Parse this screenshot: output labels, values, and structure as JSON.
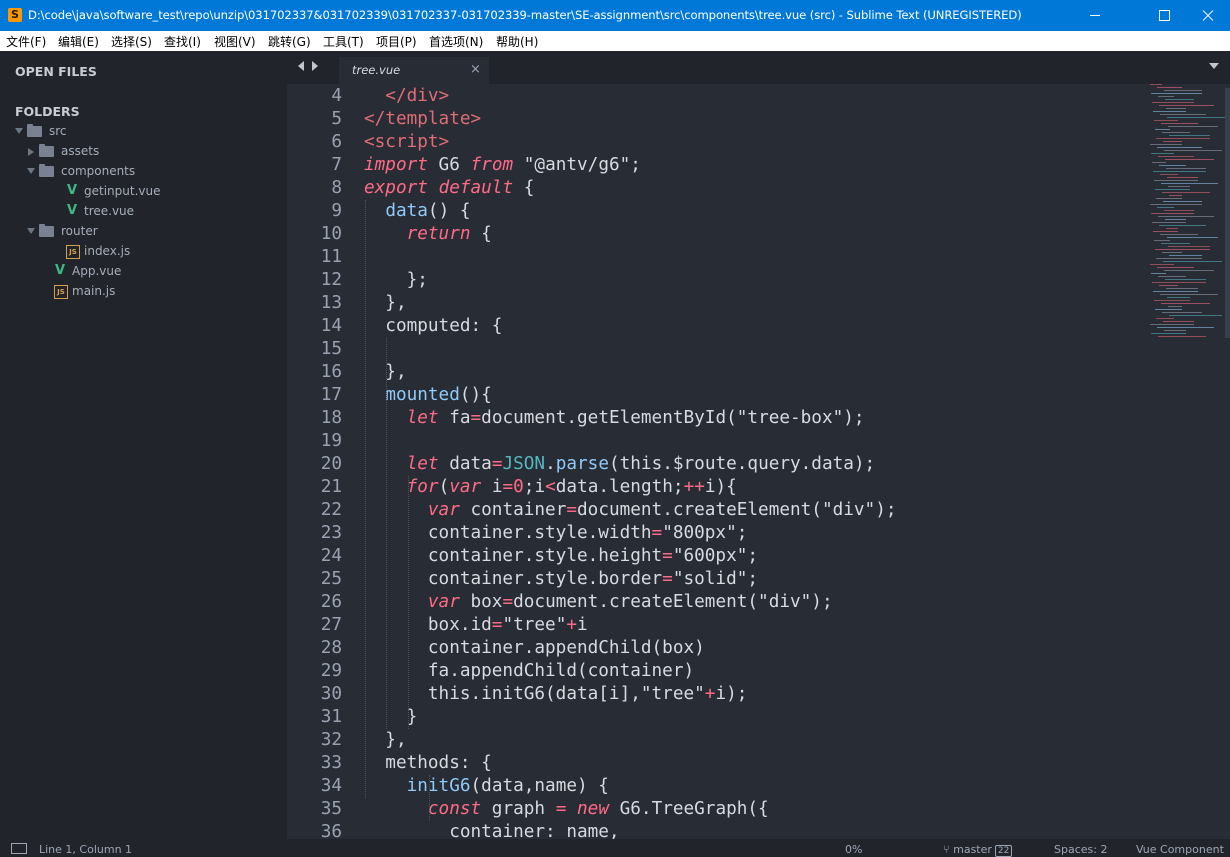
{
  "window": {
    "title": "D:\\code\\java\\software_test\\repo\\unzip\\031702337&031702339\\031702337-031702339-master\\SE-assignment\\src\\components\\tree.vue (src) - Sublime Text (UNREGISTERED)",
    "app_icon_letter": "S"
  },
  "menu": [
    "文件(F)",
    "编辑(E)",
    "选择(S)",
    "查找(I)",
    "视图(V)",
    "跳转(G)",
    "工具(T)",
    "项目(P)",
    "首选项(N)",
    "帮助(H)"
  ],
  "sidebar": {
    "open_files_label": "OPEN FILES",
    "folders_label": "FOLDERS",
    "tree": [
      {
        "name": "src",
        "type": "folder",
        "open": true,
        "depth": 0
      },
      {
        "name": "assets",
        "type": "folder",
        "open": false,
        "depth": 1
      },
      {
        "name": "components",
        "type": "folder",
        "open": true,
        "depth": 1
      },
      {
        "name": "getinput.vue",
        "type": "vue",
        "depth": 2
      },
      {
        "name": "tree.vue",
        "type": "vue",
        "depth": 2
      },
      {
        "name": "router",
        "type": "folder",
        "open": true,
        "depth": 1
      },
      {
        "name": "index.js",
        "type": "js",
        "depth": 2
      },
      {
        "name": "App.vue",
        "type": "vue",
        "depth": 1
      },
      {
        "name": "main.js",
        "type": "js",
        "depth": 1
      }
    ]
  },
  "tab": {
    "label": "tree.vue",
    "close_symbol": "×"
  },
  "editor": {
    "line_numbers": [
      4,
      5,
      6,
      7,
      8,
      9,
      10,
      11,
      12,
      13,
      14,
      15,
      16,
      17,
      18,
      19,
      20,
      21,
      22,
      23,
      24,
      25,
      26,
      27,
      28,
      29,
      30,
      31,
      32,
      33,
      34,
      35,
      36
    ],
    "lines": [
      [
        [
          "tag",
          "  </div>"
        ]
      ],
      [
        [
          "tag",
          "</template>"
        ]
      ],
      [
        [
          "tag",
          "<script>"
        ]
      ],
      [
        [
          "kw",
          "import"
        ],
        [
          "pl",
          " G6 "
        ],
        [
          "kw",
          "from"
        ],
        [
          "pl",
          " "
        ],
        [
          "str",
          "\"@antv/g6\""
        ],
        [
          "pl",
          ";"
        ]
      ],
      [
        [
          "kw",
          "export"
        ],
        [
          "pl",
          " "
        ],
        [
          "kw",
          "default"
        ],
        [
          "pl",
          " {"
        ]
      ],
      [
        [
          "pl",
          "  "
        ],
        [
          "fn",
          "data"
        ],
        [
          "pl",
          "() {"
        ]
      ],
      [
        [
          "pl",
          "    "
        ],
        [
          "kw",
          "return"
        ],
        [
          "pl",
          " {"
        ]
      ],
      [
        [
          "pl",
          ""
        ]
      ],
      [
        [
          "pl",
          "    };"
        ]
      ],
      [
        [
          "pl",
          "  },"
        ]
      ],
      [
        [
          "pl",
          "  computed: {"
        ]
      ],
      [
        [
          "pl",
          ""
        ]
      ],
      [
        [
          "pl",
          "  },"
        ]
      ],
      [
        [
          "pl",
          "  "
        ],
        [
          "fn",
          "mounted"
        ],
        [
          "pl",
          "(){"
        ]
      ],
      [
        [
          "pl",
          "    "
        ],
        [
          "kw",
          "let"
        ],
        [
          "pl",
          " fa"
        ],
        [
          "kwn",
          "="
        ],
        [
          "pl",
          "document."
        ],
        [
          "pl",
          "getElementById"
        ],
        [
          "pl",
          "("
        ],
        [
          "str",
          "\"tree-box\""
        ],
        [
          "pl",
          ");"
        ]
      ],
      [
        [
          "pl",
          ""
        ]
      ],
      [
        [
          "pl",
          "    "
        ],
        [
          "kw",
          "let"
        ],
        [
          "pl",
          " data"
        ],
        [
          "kwn",
          "="
        ],
        [
          "obj",
          "JSON"
        ],
        [
          "pl",
          "."
        ],
        [
          "fn",
          "parse"
        ],
        [
          "pl",
          "(this.$route.query.data);"
        ]
      ],
      [
        [
          "pl",
          "    "
        ],
        [
          "kw",
          "for"
        ],
        [
          "pl",
          "("
        ],
        [
          "kw",
          "var"
        ],
        [
          "pl",
          " i"
        ],
        [
          "kwn",
          "="
        ],
        [
          "num",
          "0"
        ],
        [
          "pl",
          ";i"
        ],
        [
          "kwn",
          "<"
        ],
        [
          "pl",
          "data.length;"
        ],
        [
          "kwn",
          "++"
        ],
        [
          "pl",
          "i){"
        ]
      ],
      [
        [
          "pl",
          "      "
        ],
        [
          "kw",
          "var"
        ],
        [
          "pl",
          " container"
        ],
        [
          "kwn",
          "="
        ],
        [
          "pl",
          "document.createElement("
        ],
        [
          "str",
          "\"div\""
        ],
        [
          "pl",
          ");"
        ]
      ],
      [
        [
          "pl",
          "      container.style.width"
        ],
        [
          "kwn",
          "="
        ],
        [
          "str",
          "\"800px\""
        ],
        [
          "pl",
          ";"
        ]
      ],
      [
        [
          "pl",
          "      container.style.height"
        ],
        [
          "kwn",
          "="
        ],
        [
          "str",
          "\"600px\""
        ],
        [
          "pl",
          ";"
        ]
      ],
      [
        [
          "pl",
          "      container.style.border"
        ],
        [
          "kwn",
          "="
        ],
        [
          "str",
          "\"solid\""
        ],
        [
          "pl",
          ";"
        ]
      ],
      [
        [
          "pl",
          "      "
        ],
        [
          "kw",
          "var"
        ],
        [
          "pl",
          " box"
        ],
        [
          "kwn",
          "="
        ],
        [
          "pl",
          "document.createElement("
        ],
        [
          "str",
          "\"div\""
        ],
        [
          "pl",
          ");"
        ]
      ],
      [
        [
          "pl",
          "      box.id"
        ],
        [
          "kwn",
          "="
        ],
        [
          "str",
          "\"tree\""
        ],
        [
          "kwn",
          "+"
        ],
        [
          "pl",
          "i"
        ]
      ],
      [
        [
          "pl",
          "      container.appendChild(box)"
        ]
      ],
      [
        [
          "pl",
          "      fa.appendChild(container)"
        ]
      ],
      [
        [
          "pl",
          "      this.initG6(data[i],"
        ],
        [
          "str",
          "\"tree\""
        ],
        [
          "kwn",
          "+"
        ],
        [
          "pl",
          "i);"
        ]
      ],
      [
        [
          "pl",
          "    }"
        ]
      ],
      [
        [
          "pl",
          "  },"
        ]
      ],
      [
        [
          "pl",
          "  methods: {"
        ]
      ],
      [
        [
          "pl",
          "    "
        ],
        [
          "fn",
          "initG6"
        ],
        [
          "pl",
          "(data,name) {"
        ]
      ],
      [
        [
          "pl",
          "      "
        ],
        [
          "kw",
          "const"
        ],
        [
          "pl",
          " graph "
        ],
        [
          "kwn",
          "="
        ],
        [
          "pl",
          " "
        ],
        [
          "kw",
          "new"
        ],
        [
          "pl",
          " G6.TreeGraph({"
        ]
      ],
      [
        [
          "pl",
          "        container: name,"
        ]
      ]
    ]
  },
  "status": {
    "position": "Line 1, Column 1",
    "progress": "0%",
    "branch": "master",
    "branch_changes": "22",
    "indent": "Spaces: 2",
    "syntax": "Vue Component"
  },
  "colors": {
    "keyword": "#ff6b86",
    "tag": "#e06c75",
    "function": "#90caf9",
    "object": "#56b6c2",
    "plain": "#d7dae0",
    "vue_icon": "#41b883",
    "titlebar": "#0078d7"
  }
}
